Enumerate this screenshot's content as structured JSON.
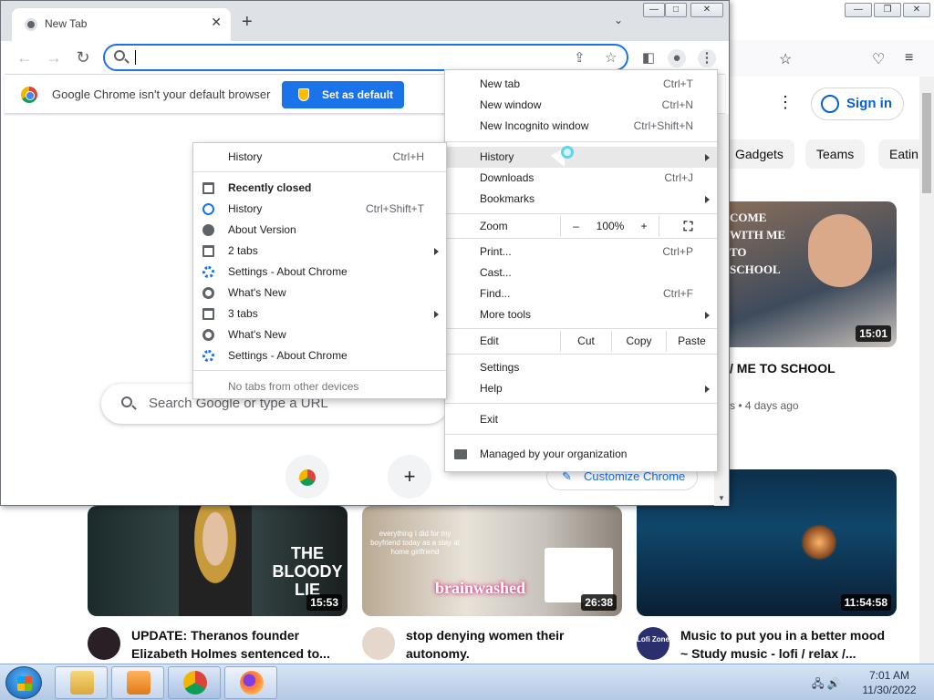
{
  "youtube": {
    "signin_label": "Sign in",
    "chips": [
      "Gadgets",
      "Teams",
      "Eatin"
    ],
    "top_video": {
      "overlay_text": "COME WITH ME TO SCHOOL",
      "duration": "15:01",
      "title": "/ ME TO SCHOOL",
      "meta": "s • 4 days ago"
    },
    "videos": [
      {
        "duration": "15:53",
        "overlay_text": "THE BLOODY LIE",
        "title_line1": "UPDATE: Theranos founder",
        "title_line2": "Elizabeth Holmes sentenced to..."
      },
      {
        "duration": "26:38",
        "overlay_text": "brainwashed",
        "caption": "everything I did for my boyfriend today as a stay at home girlfriend",
        "title_line1": "stop denying women their",
        "title_line2": "autonomy."
      },
      {
        "duration": "11:54:58",
        "title_line1": "Music to put you in a better mood",
        "title_line2": "~ Study music - lofi / relax /...",
        "avatar_text": "Lofi Zone"
      }
    ]
  },
  "chrome": {
    "tab_title": "New Tab",
    "tab_close": "✕",
    "new_tab_symbol": "+",
    "tab_search_symbol": "⌄",
    "omnibox_value": "",
    "infobar_message": "Google Chrome isn't your default browser",
    "set_default_label": "Set as default",
    "ntp_search_placeholder": "Search Google or type a URL",
    "add_shortcut_symbol": "+",
    "customize_label": "Customize Chrome",
    "window_controls": [
      "—",
      "□",
      "✕"
    ]
  },
  "main_menu": {
    "new_tab": {
      "label": "New tab",
      "shortcut": "Ctrl+T"
    },
    "new_window": {
      "label": "New window",
      "shortcut": "Ctrl+N"
    },
    "new_incognito": {
      "label": "New Incognito window",
      "shortcut": "Ctrl+Shift+N"
    },
    "history": {
      "label": "History"
    },
    "downloads": {
      "label": "Downloads",
      "shortcut": "Ctrl+J"
    },
    "bookmarks": {
      "label": "Bookmarks"
    },
    "zoom": {
      "label": "Zoom",
      "minus": "–",
      "level": "100%",
      "plus": "+"
    },
    "print": {
      "label": "Print...",
      "shortcut": "Ctrl+P"
    },
    "cast": {
      "label": "Cast..."
    },
    "find": {
      "label": "Find...",
      "shortcut": "Ctrl+F"
    },
    "more_tools": {
      "label": "More tools"
    },
    "edit": {
      "label": "Edit",
      "cut": "Cut",
      "copy": "Copy",
      "paste": "Paste"
    },
    "settings": {
      "label": "Settings"
    },
    "help": {
      "label": "Help"
    },
    "exit": {
      "label": "Exit"
    },
    "managed": {
      "label": "Managed by your organization"
    }
  },
  "history_menu": {
    "history": {
      "label": "History",
      "shortcut": "Ctrl+H"
    },
    "recently_closed": "Recently closed",
    "items": [
      {
        "label": "History",
        "shortcut": "Ctrl+Shift+T",
        "icon": "history-icon"
      },
      {
        "label": "About Version",
        "shortcut": "",
        "icon": "globe-icon"
      },
      {
        "label": "2 tabs",
        "shortcut": "",
        "icon": "tab-icon"
      },
      {
        "label": "Settings - About Chrome",
        "shortcut": "",
        "icon": "settings-icon"
      },
      {
        "label": "What's New",
        "shortcut": "",
        "icon": "chrome-icon"
      },
      {
        "label": "3 tabs",
        "shortcut": "",
        "icon": "tab-icon"
      },
      {
        "label": "What's New",
        "shortcut": "",
        "icon": "chrome-icon"
      },
      {
        "label": "Settings - About Chrome",
        "shortcut": "",
        "icon": "settings-icon"
      }
    ],
    "no_tabs": "No tabs from other devices"
  },
  "taskbar": {
    "time": "7:01 AM",
    "date": "11/30/2022",
    "items": [
      "explorer",
      "media-player",
      "chrome",
      "firefox"
    ]
  },
  "colors": {
    "accent": "#1a73e8",
    "youtube_link": "#065fd4",
    "taskbar": "#c5d6ed"
  }
}
